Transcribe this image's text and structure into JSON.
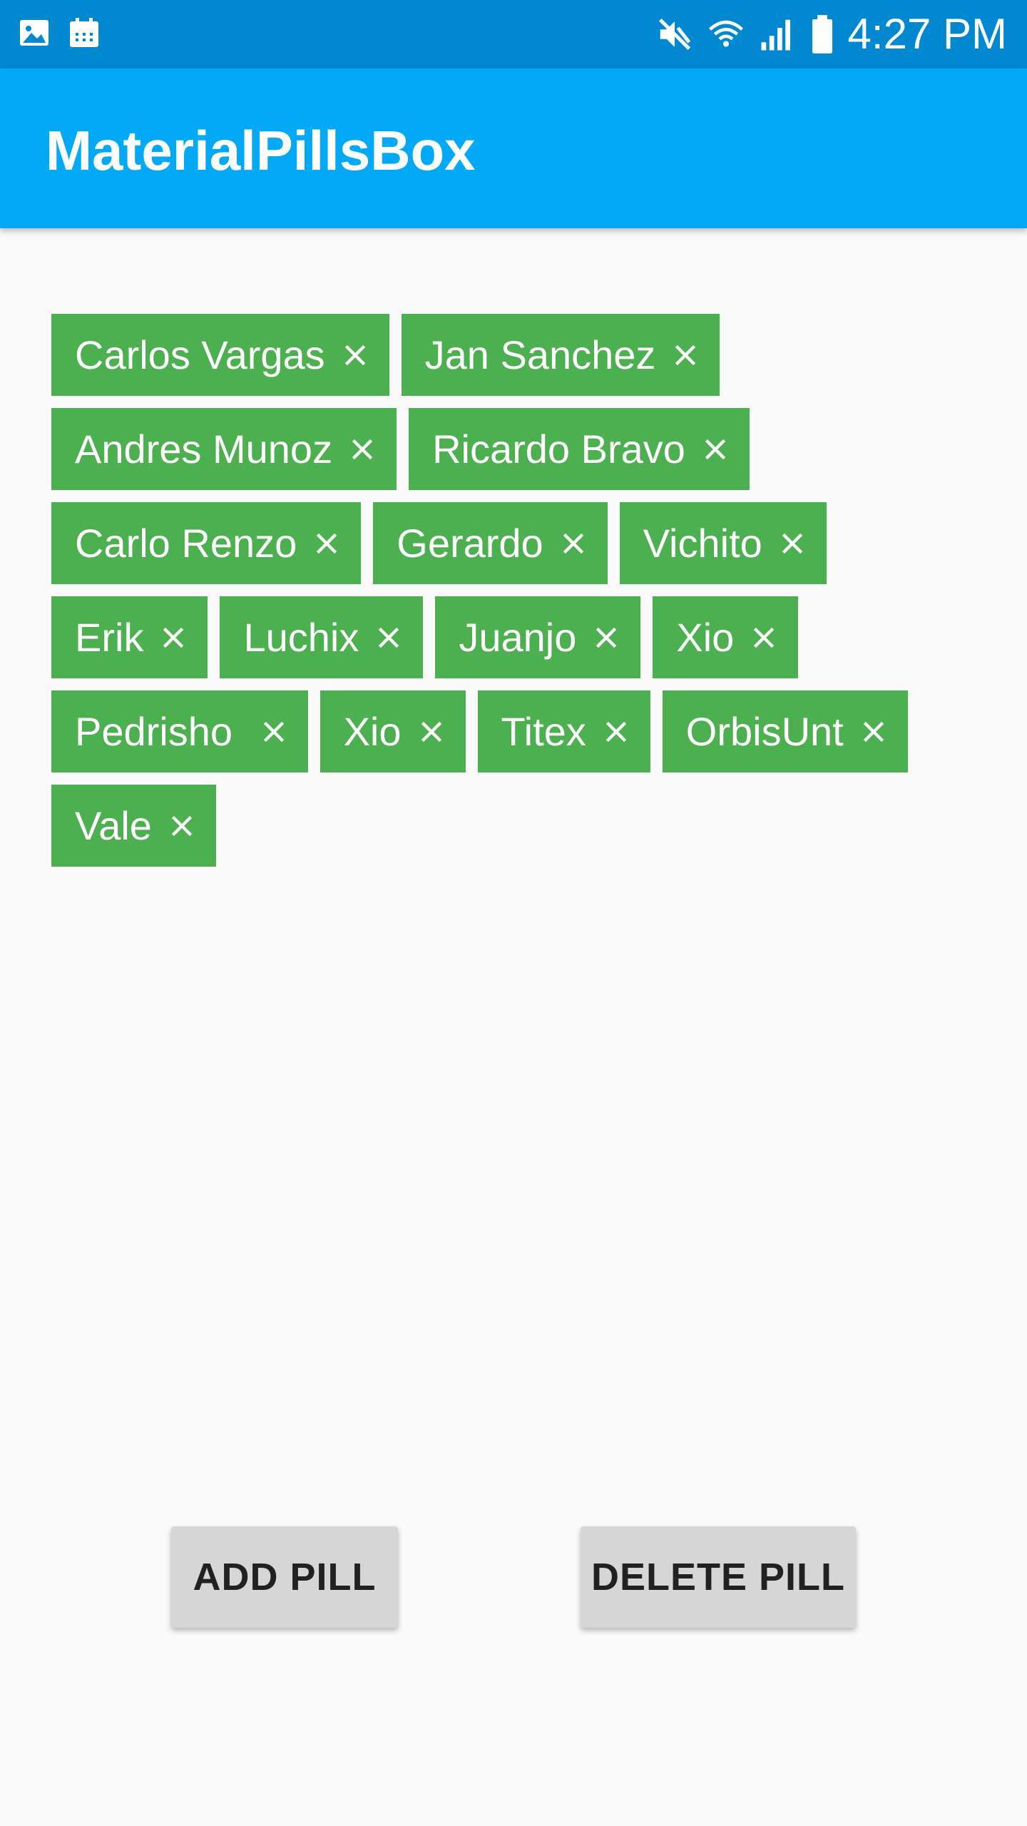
{
  "status_bar": {
    "time": "4:27 PM",
    "left_icons": [
      "image-icon",
      "calendar-icon"
    ],
    "right_icons": [
      "mute-icon",
      "wifi-icon",
      "signal-icon",
      "battery-icon"
    ]
  },
  "app_bar": {
    "title": "MaterialPillsBox",
    "color": "#03a9f4"
  },
  "pills": {
    "color": "#4caf50",
    "close_icon": "close-icon",
    "items": [
      {
        "label": "Carlos Vargas"
      },
      {
        "label": "Jan Sanchez"
      },
      {
        "label": "Andres Munoz"
      },
      {
        "label": "Ricardo Bravo"
      },
      {
        "label": "Carlo Renzo"
      },
      {
        "label": "Gerardo"
      },
      {
        "label": "Vichito"
      },
      {
        "label": "Erik"
      },
      {
        "label": "Luchix"
      },
      {
        "label": "Juanjo"
      },
      {
        "label": "Xio"
      },
      {
        "label": "Pedrisho "
      },
      {
        "label": "Xio"
      },
      {
        "label": "Titex"
      },
      {
        "label": "OrbisUnt"
      },
      {
        "label": "Vale"
      }
    ]
  },
  "buttons": {
    "add_label": "ADD PILL",
    "delete_label": "DELETE PILL"
  }
}
